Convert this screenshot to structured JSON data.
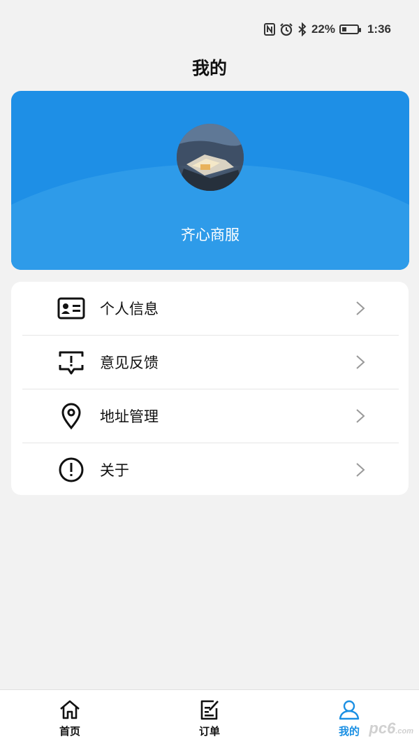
{
  "status_bar": {
    "battery": "22%",
    "time": "1:36",
    "icons": [
      "nfc-icon",
      "alarm-icon",
      "bluetooth-icon",
      "battery-icon"
    ]
  },
  "header": {
    "title": "我的"
  },
  "profile": {
    "name": "齐心商服"
  },
  "menu": {
    "items": [
      {
        "label": "个人信息",
        "icon": "id-card-icon"
      },
      {
        "label": "意见反馈",
        "icon": "feedback-icon"
      },
      {
        "label": "地址管理",
        "icon": "location-pin-icon"
      },
      {
        "label": "关于",
        "icon": "info-exclamation-icon"
      }
    ]
  },
  "tab_bar": {
    "tabs": [
      {
        "label": "首页",
        "icon": "home-icon",
        "active": false
      },
      {
        "label": "订单",
        "icon": "order-edit-icon",
        "active": false
      },
      {
        "label": "我的",
        "icon": "user-icon",
        "active": true
      }
    ]
  },
  "watermark": {
    "text": "pc6",
    "suffix": ".com"
  },
  "colors": {
    "accent": "#1a8fe3",
    "card_blue": "#1e8fe6"
  }
}
